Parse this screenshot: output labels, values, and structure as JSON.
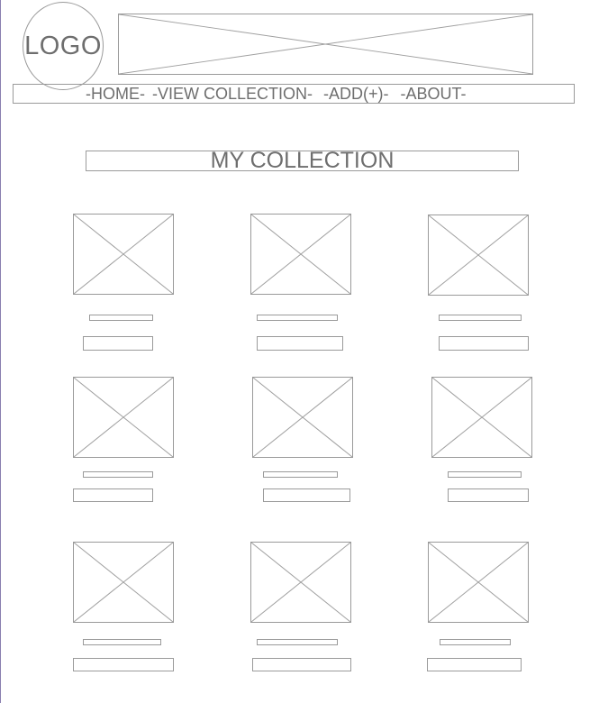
{
  "header": {
    "logo_text": "LOGO",
    "banner_icon": "image-placeholder-icon"
  },
  "nav": {
    "items": [
      {
        "label": "-HOME-"
      },
      {
        "label": "-VIEW COLLECTION-"
      },
      {
        "label": "-ADD(+)-"
      },
      {
        "label": "-ABOUT-"
      }
    ]
  },
  "main": {
    "title": "MY COLLECTION",
    "card_icon": "image-placeholder-icon",
    "card_count": 9
  },
  "colors": {
    "wireframe_stroke": "#9a9a9a",
    "text": "#6e6e6e",
    "background": "#ffffff"
  }
}
